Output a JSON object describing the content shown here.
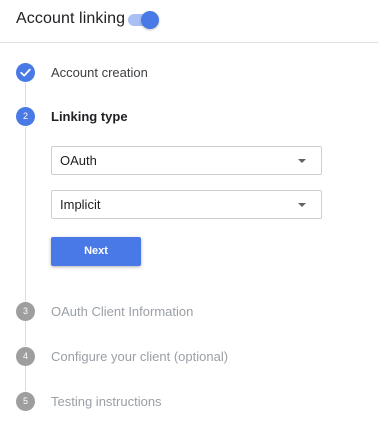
{
  "header": {
    "title": "Account linking",
    "toggle_on": true
  },
  "steps": [
    {
      "number": "",
      "label": "Account creation",
      "state": "done"
    },
    {
      "number": "2",
      "label": "Linking type",
      "state": "active"
    },
    {
      "number": "3",
      "label": "OAuth Client Information",
      "state": "pending"
    },
    {
      "number": "4",
      "label": "Configure your client (optional)",
      "state": "pending"
    },
    {
      "number": "5",
      "label": "Testing instructions",
      "state": "pending"
    }
  ],
  "linking": {
    "grant_type": "OAuth",
    "flow": "Implicit",
    "next_label": "Next"
  },
  "colors": {
    "accent": "#4979e6",
    "pending": "#9e9e9e"
  },
  "icons": {
    "done_step": "check-icon",
    "dropdown": "caret-down-icon"
  }
}
